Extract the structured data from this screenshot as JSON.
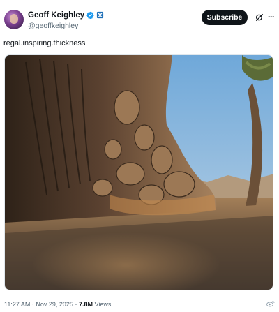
{
  "author": {
    "display_name": "Geoff Keighley",
    "handle": "@geoffkeighley"
  },
  "header": {
    "subscribe_label": "Subscribe",
    "more_label": "···"
  },
  "tweet": {
    "text": "regal.inspiring.thickness"
  },
  "meta": {
    "time": "11:27 AM",
    "separator": "·",
    "date": "Nov 29, 2025",
    "views_count": "7.8M",
    "views_label": "Views"
  },
  "icons": {
    "verified": "verified-badge-icon",
    "affiliate": "affiliate-badge-icon",
    "grok": "grok-icon",
    "more": "more-icon"
  },
  "colors": {
    "accent": "#1d9bf0",
    "button_bg": "#0f1419",
    "secondary_text": "#536471"
  }
}
